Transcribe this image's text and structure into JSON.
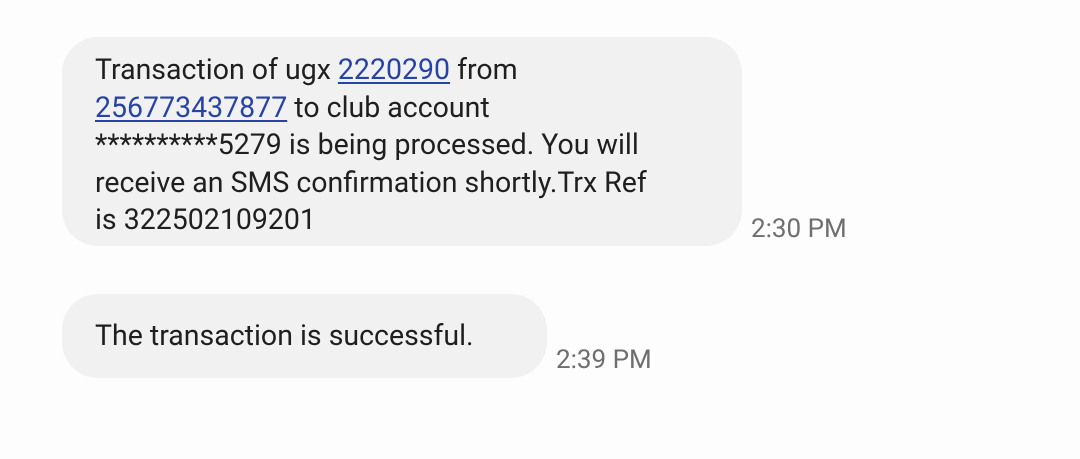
{
  "messages": [
    {
      "line1_pre": "Transaction of ugx ",
      "line1_link": "2220290",
      "line1_post": " from",
      "line2_link": "256773437877",
      "line2_post": " to club account",
      "line3": "**********5279 is being processed. You will",
      "line4": "receive an SMS confirmation shortly.Trx Ref",
      "line5": "is 322502109201",
      "time": "2:30 PM"
    },
    {
      "text": "The transaction is successful.",
      "time": "2:39 PM"
    }
  ],
  "colors": {
    "background": "#fdfdfd",
    "bubble": "#f1f1f1",
    "text": "#1f1f1f",
    "link": "#2743a5",
    "timestamp": "#6e6e6e"
  }
}
